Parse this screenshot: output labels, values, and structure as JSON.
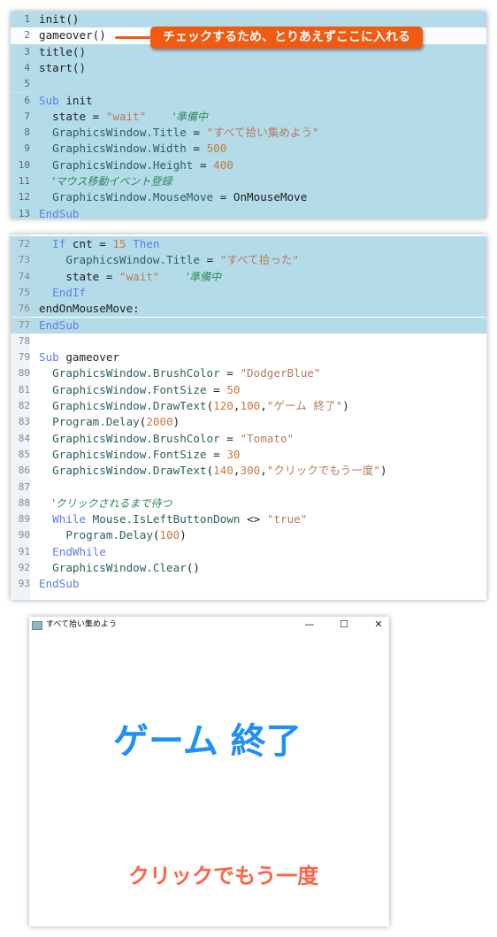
{
  "annotation": {
    "text": "チェックするため、とりあえずここに入れる",
    "color": "#f25a12"
  },
  "colors": {
    "highlight_bg": "#b3dbe8",
    "keyword": "#5d7ee6",
    "string": "#b8795c",
    "number": "#c77a3c",
    "comment": "#2f8a5a"
  },
  "panel1": {
    "lines": [
      {
        "n": "1",
        "hl": true,
        "tokens": [
          [
            "plain",
            "init()"
          ]
        ]
      },
      {
        "n": "2",
        "cur": true,
        "tokens": [
          [
            "plain",
            "gameover()"
          ]
        ]
      },
      {
        "n": "3",
        "hl": true,
        "tokens": [
          [
            "plain",
            "title()"
          ]
        ]
      },
      {
        "n": "4",
        "hl": true,
        "tokens": [
          [
            "plain",
            "start()"
          ]
        ]
      },
      {
        "n": "5",
        "hl": true,
        "tokens": []
      },
      {
        "n": "6",
        "hl": true,
        "tokens": [
          [
            "kw",
            "Sub"
          ],
          [
            "plain",
            " init"
          ]
        ]
      },
      {
        "n": "7",
        "hl": true,
        "tokens": [
          [
            "plain",
            "  state = "
          ],
          [
            "str",
            "\"wait\""
          ],
          [
            "plain",
            "    "
          ],
          [
            "cmt",
            "'準備中"
          ]
        ]
      },
      {
        "n": "8",
        "hl": true,
        "tokens": [
          [
            "obj",
            "  GraphicsWindow.Title"
          ],
          [
            "plain",
            " = "
          ],
          [
            "str",
            "\"すべて拾い集めよう\""
          ]
        ]
      },
      {
        "n": "9",
        "hl": true,
        "tokens": [
          [
            "obj",
            "  GraphicsWindow.Width"
          ],
          [
            "plain",
            " = "
          ],
          [
            "num",
            "500"
          ]
        ]
      },
      {
        "n": "10",
        "hl": true,
        "tokens": [
          [
            "obj",
            "  GraphicsWindow.Height"
          ],
          [
            "plain",
            " = "
          ],
          [
            "num",
            "400"
          ]
        ]
      },
      {
        "n": "11",
        "hl": true,
        "tokens": [
          [
            "plain",
            "  "
          ],
          [
            "cmt",
            "'マウス移動イベント登録"
          ]
        ]
      },
      {
        "n": "12",
        "hl": true,
        "tokens": [
          [
            "obj",
            "  GraphicsWindow.MouseMove"
          ],
          [
            "plain",
            " = OnMouseMove"
          ]
        ]
      },
      {
        "n": "13",
        "hl": true,
        "tokens": [
          [
            "kw",
            "EndSub"
          ]
        ]
      }
    ]
  },
  "panel2": {
    "lines": [
      {
        "n": "72",
        "hl": true,
        "tokens": [
          [
            "plain",
            "  "
          ],
          [
            "kw",
            "If"
          ],
          [
            "plain",
            " cnt = "
          ],
          [
            "num",
            "15"
          ],
          [
            "plain",
            " "
          ],
          [
            "kw",
            "Then"
          ]
        ]
      },
      {
        "n": "73",
        "hl": true,
        "tokens": [
          [
            "obj",
            "    GraphicsWindow.Title"
          ],
          [
            "plain",
            " = "
          ],
          [
            "str",
            "\"すべて拾った\""
          ]
        ]
      },
      {
        "n": "74",
        "hl": true,
        "tokens": [
          [
            "plain",
            "    state = "
          ],
          [
            "str",
            "\"wait\""
          ],
          [
            "plain",
            "    "
          ],
          [
            "cmt",
            "'準備中"
          ]
        ]
      },
      {
        "n": "75",
        "hl": true,
        "tokens": [
          [
            "plain",
            "  "
          ],
          [
            "kw",
            "EndIf"
          ]
        ]
      },
      {
        "n": "76",
        "hl": true,
        "tokens": [
          [
            "plain",
            "endOnMouseMove:"
          ]
        ]
      },
      {
        "n": "77",
        "hl": true,
        "tokens": [
          [
            "kw",
            "EndSub"
          ]
        ]
      },
      {
        "n": "78",
        "tokens": []
      },
      {
        "n": "79",
        "tokens": [
          [
            "kw",
            "Sub"
          ],
          [
            "plain",
            " gameover"
          ]
        ]
      },
      {
        "n": "80",
        "tokens": [
          [
            "obj",
            "  GraphicsWindow.BrushColor"
          ],
          [
            "plain",
            " = "
          ],
          [
            "str",
            "\"DodgerBlue\""
          ]
        ]
      },
      {
        "n": "81",
        "tokens": [
          [
            "obj",
            "  GraphicsWindow.FontSize"
          ],
          [
            "plain",
            " = "
          ],
          [
            "num",
            "50"
          ]
        ]
      },
      {
        "n": "82",
        "tokens": [
          [
            "obj",
            "  GraphicsWindow.DrawText"
          ],
          [
            "plain",
            "("
          ],
          [
            "num",
            "120"
          ],
          [
            "plain",
            ","
          ],
          [
            "num",
            "100"
          ],
          [
            "plain",
            ","
          ],
          [
            "str",
            "\"ゲーム 終了\""
          ],
          [
            "plain",
            ")"
          ]
        ]
      },
      {
        "n": "83",
        "tokens": [
          [
            "obj",
            "  Program.Delay"
          ],
          [
            "plain",
            "("
          ],
          [
            "num",
            "2000"
          ],
          [
            "plain",
            ")"
          ]
        ]
      },
      {
        "n": "84",
        "tokens": [
          [
            "obj",
            "  GraphicsWindow.BrushColor"
          ],
          [
            "plain",
            " = "
          ],
          [
            "str",
            "\"Tomato\""
          ]
        ]
      },
      {
        "n": "85",
        "tokens": [
          [
            "obj",
            "  GraphicsWindow.FontSize"
          ],
          [
            "plain",
            " = "
          ],
          [
            "num",
            "30"
          ]
        ]
      },
      {
        "n": "86",
        "tokens": [
          [
            "obj",
            "  GraphicsWindow.DrawText"
          ],
          [
            "plain",
            "("
          ],
          [
            "num",
            "140"
          ],
          [
            "plain",
            ","
          ],
          [
            "num",
            "300"
          ],
          [
            "plain",
            ","
          ],
          [
            "str",
            "\"クリックでもう一度\""
          ],
          [
            "plain",
            ")"
          ]
        ]
      },
      {
        "n": "87",
        "tokens": []
      },
      {
        "n": "88",
        "tokens": [
          [
            "plain",
            "  "
          ],
          [
            "cmt",
            "'クリックされるまで待つ"
          ]
        ]
      },
      {
        "n": "89",
        "tokens": [
          [
            "plain",
            "  "
          ],
          [
            "kw",
            "While"
          ],
          [
            "obj",
            " Mouse.IsLeftButtonDown"
          ],
          [
            "plain",
            " <> "
          ],
          [
            "str",
            "\"true\""
          ]
        ]
      },
      {
        "n": "90",
        "tokens": [
          [
            "obj",
            "    Program.Delay"
          ],
          [
            "plain",
            "("
          ],
          [
            "num",
            "100"
          ],
          [
            "plain",
            ")"
          ]
        ]
      },
      {
        "n": "91",
        "tokens": [
          [
            "plain",
            "  "
          ],
          [
            "kw",
            "EndWhile"
          ]
        ]
      },
      {
        "n": "92",
        "tokens": [
          [
            "obj",
            "  GraphicsWindow.Clear"
          ],
          [
            "plain",
            "()"
          ]
        ]
      },
      {
        "n": "93",
        "tokens": [
          [
            "kw",
            "EndSub"
          ]
        ]
      }
    ]
  },
  "window": {
    "title": "すべて拾い集めよう",
    "minimize": "—",
    "maximize": "☐",
    "close": "✕",
    "game_over_text": "ゲーム 終了",
    "game_over_color": "#1e90ff",
    "retry_text": "クリックでもう一度",
    "retry_color": "#ff6347"
  }
}
